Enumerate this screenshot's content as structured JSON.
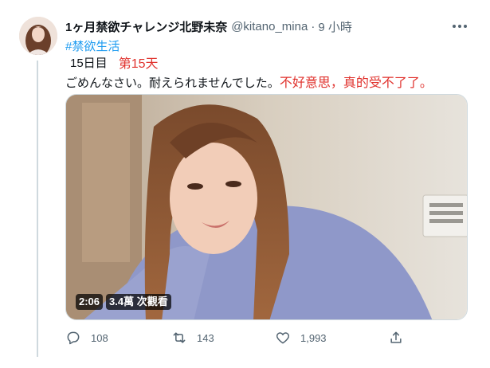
{
  "tweet": {
    "author": {
      "display_name": "1ヶ月禁欲チャレンジ北野未奈",
      "handle": "@kitano_mina",
      "separator": "·",
      "time": "9 小時",
      "avatar_icon": "avatar-photo"
    },
    "hashtag": "#禁欲生活",
    "day_label_jp": "15日目",
    "day_label_cn": "第15天",
    "text_jp": "ごめんなさい。耐えられませんでした。",
    "text_cn": "不好意思，真的受不了了。",
    "media": {
      "duration": "2:06",
      "views": "3.4萬 次觀看"
    },
    "actions": {
      "reply_count": "108",
      "retweet_count": "143",
      "like_count": "1,993",
      "reply_icon": "reply-icon",
      "retweet_icon": "retweet-icon",
      "like_icon": "heart-icon",
      "share_icon": "share-icon"
    }
  },
  "colors": {
    "link": "#1d9bf0",
    "red_text": "#e0312c",
    "muted": "#536471",
    "thread_line": "#cfd9de"
  }
}
